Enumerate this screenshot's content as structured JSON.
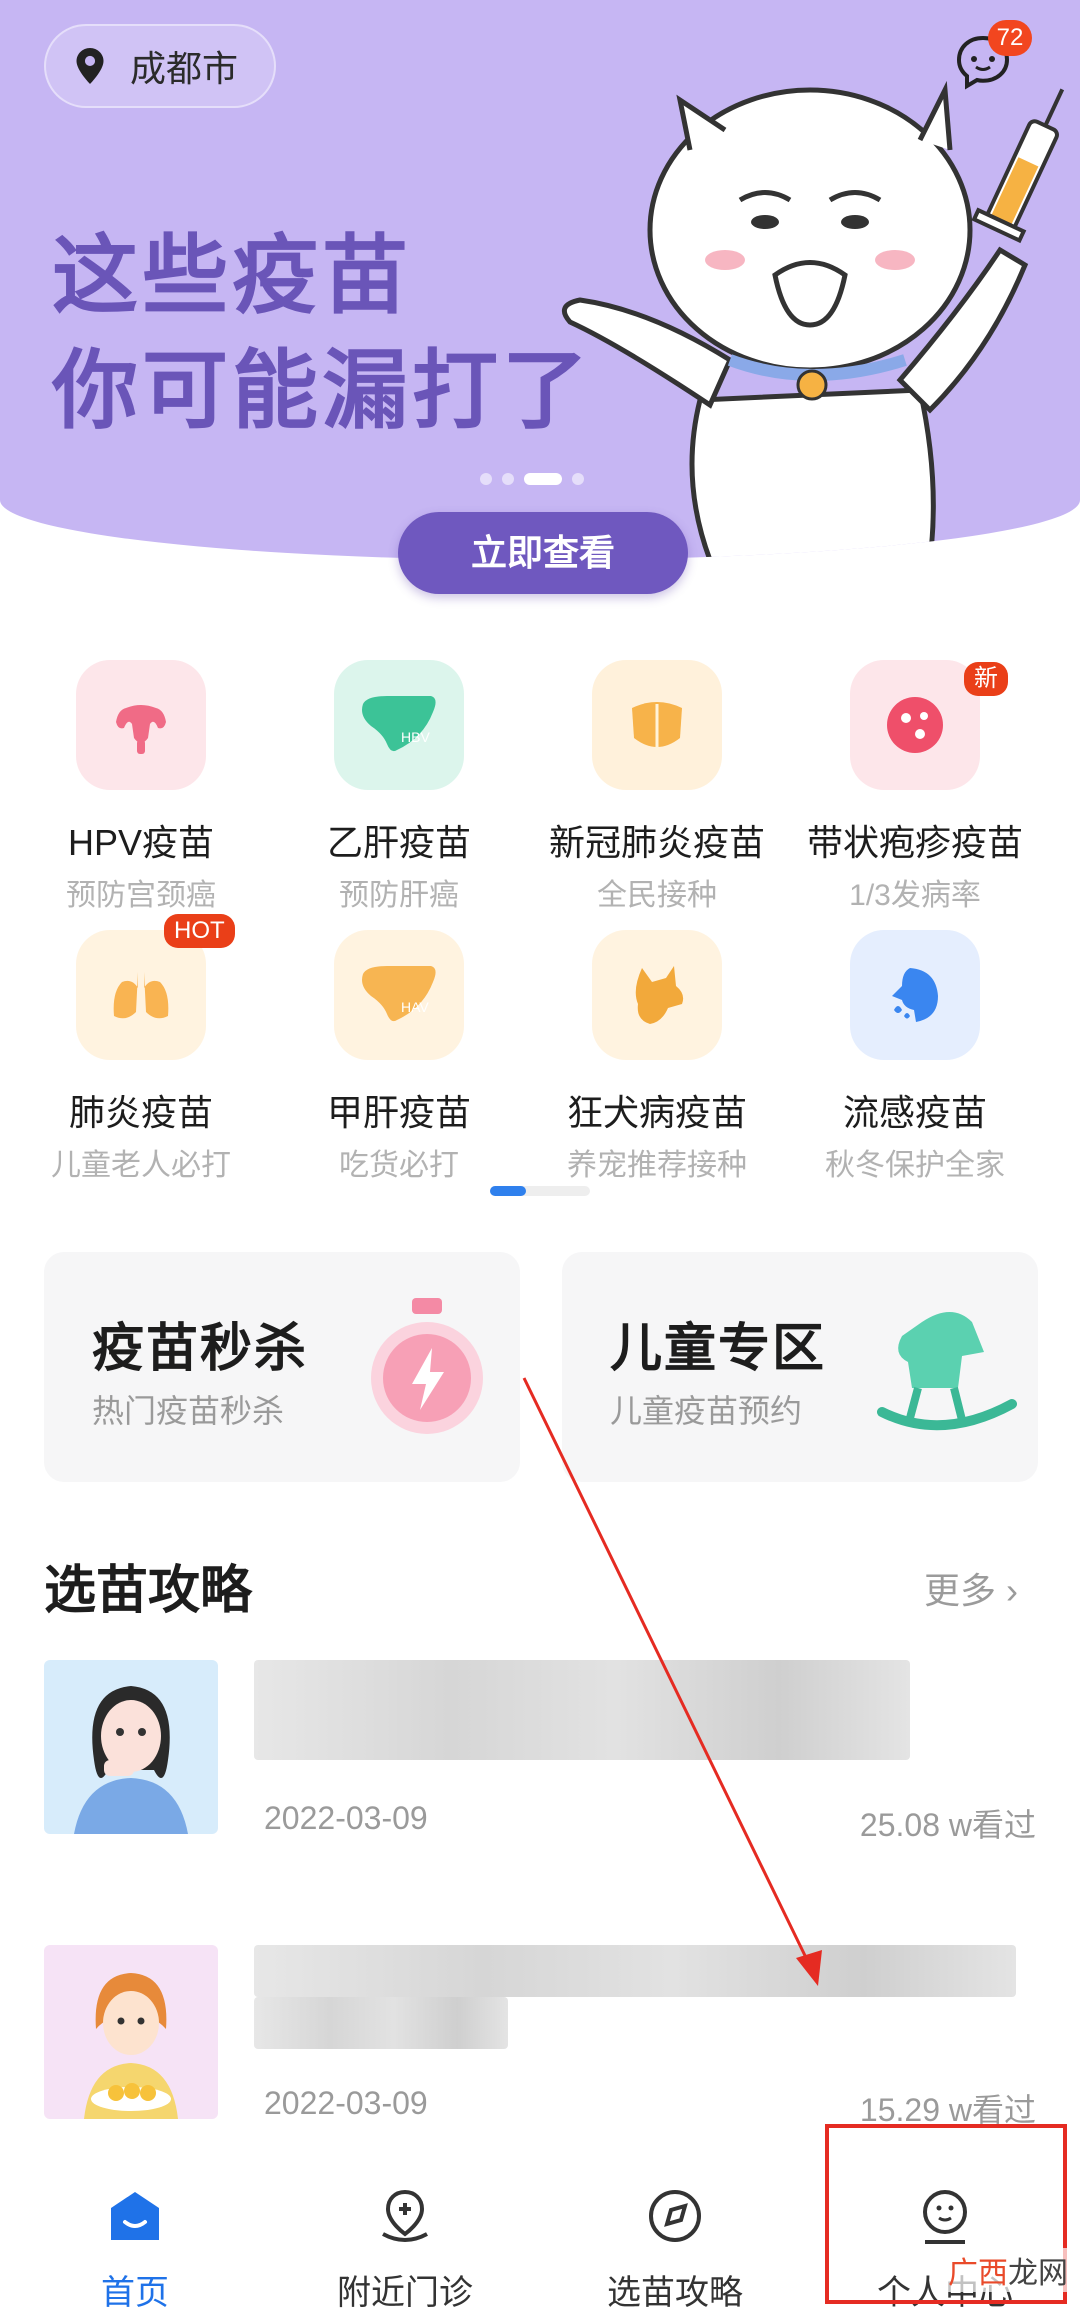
{
  "banner": {
    "city": "成都市",
    "message_badge": "72",
    "headline_line1": "这些疫苗",
    "headline_line2": "你可能漏打了",
    "cta": "立即查看"
  },
  "categories": [
    {
      "name": "HPV疫苗",
      "sub": "预防宫颈癌",
      "icon": "uterus-icon",
      "bg": "#fde6ea",
      "color": "#f06b86",
      "tag": ""
    },
    {
      "name": "乙肝疫苗",
      "sub": "预防肝癌",
      "icon": "liver-hbv-icon",
      "bg": "#dcf5ec",
      "color": "#3cc397",
      "tag": ""
    },
    {
      "name": "新冠肺炎疫苗",
      "sub": "全民接种",
      "icon": "mask-icon",
      "bg": "#fff1db",
      "color": "#f7b34a",
      "tag": ""
    },
    {
      "name": "带状疱疹疫苗",
      "sub": "1/3发病率",
      "icon": "virus-icon",
      "bg": "#fde6ea",
      "color": "#ef4f6a",
      "tag": "新"
    },
    {
      "name": "肺炎疫苗",
      "sub": "儿童老人必打",
      "icon": "lungs-icon",
      "bg": "#fff3e0",
      "color": "#f9b452",
      "tag": "HOT"
    },
    {
      "name": "甲肝疫苗",
      "sub": "吃货必打",
      "icon": "liver-hav-icon",
      "bg": "#fff3e0",
      "color": "#f7b552",
      "tag": ""
    },
    {
      "name": "狂犬病疫苗",
      "sub": "养宠推荐接种",
      "icon": "dog-icon",
      "bg": "#fff3e0",
      "color": "#f2a93b",
      "tag": ""
    },
    {
      "name": "流感疫苗",
      "sub": "秋冬保护全家",
      "icon": "sneeze-icon",
      "bg": "#e5eefe",
      "color": "#3a86f0",
      "tag": ""
    }
  ],
  "promo": {
    "flash_title": "疫苗秒杀",
    "flash_sub": "热门疫苗秒杀",
    "kids_title": "儿童专区",
    "kids_sub": "儿童疫苗预约"
  },
  "guides": {
    "title": "选苗攻略",
    "more": "更多",
    "articles": [
      {
        "date": "2022-03-09",
        "views": "25.08 w看过"
      },
      {
        "date": "2022-03-09",
        "views": "15.29 w看过"
      }
    ]
  },
  "tabbar": {
    "home": "首页",
    "nearby": "附近门诊",
    "guides": "选苗攻略",
    "profile": "个人中心"
  },
  "watermark": {
    "brand": "广西",
    "site": "龙网"
  },
  "colors": {
    "accent": "#1f72e8",
    "banner": "#c6b6f3",
    "cta": "#6f58bf",
    "alert": "#e52b22"
  }
}
